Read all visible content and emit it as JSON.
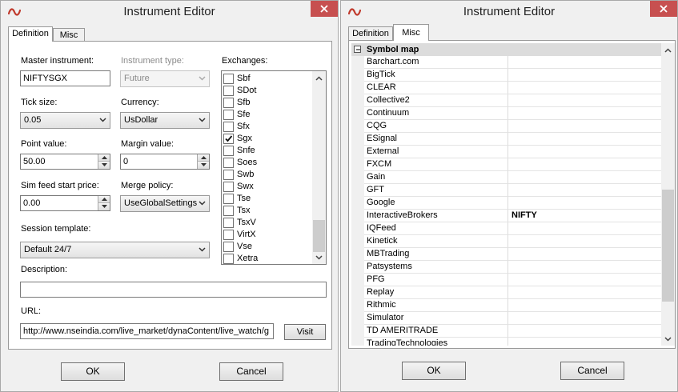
{
  "left_window": {
    "title": "Instrument Editor",
    "tabs": [
      "Definition",
      "Misc"
    ],
    "master_instrument": {
      "label": "Master instrument:",
      "value": "NIFTYSGX"
    },
    "instrument_type": {
      "label": "Instrument type:",
      "value": "Future"
    },
    "tick_size": {
      "label": "Tick size:",
      "value": "0.05"
    },
    "currency": {
      "label": "Currency:",
      "value": "UsDollar"
    },
    "point_value": {
      "label": "Point value:",
      "value": "50.00"
    },
    "margin_value": {
      "label": "Margin value:",
      "value": "0"
    },
    "sim_feed_start_price": {
      "label": "Sim feed start price:",
      "value": "0.00"
    },
    "merge_policy": {
      "label": "Merge policy:",
      "value": "UseGlobalSettings"
    },
    "session_template": {
      "label": "Session template:",
      "value": "Default 24/7"
    },
    "description": {
      "label": "Description:",
      "value": ""
    },
    "url": {
      "label": "URL:",
      "value": "http://www.nseindia.com/live_market/dynaContent/live_watch/g",
      "button": "Visit"
    },
    "exchanges": {
      "label": "Exchanges:",
      "items": [
        {
          "name": "Sbf",
          "checked": false
        },
        {
          "name": "SDot",
          "checked": false
        },
        {
          "name": "Sfb",
          "checked": false
        },
        {
          "name": "Sfe",
          "checked": false
        },
        {
          "name": "Sfx",
          "checked": false
        },
        {
          "name": "Sgx",
          "checked": true
        },
        {
          "name": "Snfe",
          "checked": false
        },
        {
          "name": "Soes",
          "checked": false
        },
        {
          "name": "Swb",
          "checked": false
        },
        {
          "name": "Swx",
          "checked": false
        },
        {
          "name": "Tse",
          "checked": false
        },
        {
          "name": "Tsx",
          "checked": false
        },
        {
          "name": "TsxV",
          "checked": false
        },
        {
          "name": "VirtX",
          "checked": false
        },
        {
          "name": "Vse",
          "checked": false
        },
        {
          "name": "Xetra",
          "checked": false
        }
      ]
    },
    "ok_label": "OK",
    "cancel_label": "Cancel"
  },
  "right_window": {
    "title": "Instrument Editor",
    "tabs": [
      "Definition",
      "Misc"
    ],
    "category": "Symbol map",
    "rows": [
      {
        "name": "Barchart.com",
        "value": ""
      },
      {
        "name": "BigTick",
        "value": ""
      },
      {
        "name": "CLEAR",
        "value": ""
      },
      {
        "name": "Collective2",
        "value": ""
      },
      {
        "name": "Continuum",
        "value": ""
      },
      {
        "name": "CQG",
        "value": ""
      },
      {
        "name": "ESignal",
        "value": ""
      },
      {
        "name": "External",
        "value": ""
      },
      {
        "name": "FXCM",
        "value": ""
      },
      {
        "name": "Gain",
        "value": ""
      },
      {
        "name": "GFT",
        "value": ""
      },
      {
        "name": "Google",
        "value": ""
      },
      {
        "name": "InteractiveBrokers",
        "value": "NIFTY"
      },
      {
        "name": "IQFeed",
        "value": ""
      },
      {
        "name": "Kinetick",
        "value": ""
      },
      {
        "name": "MBTrading",
        "value": ""
      },
      {
        "name": "Patsystems",
        "value": ""
      },
      {
        "name": "PFG",
        "value": ""
      },
      {
        "name": "Replay",
        "value": ""
      },
      {
        "name": "Rithmic",
        "value": ""
      },
      {
        "name": "Simulator",
        "value": ""
      },
      {
        "name": "TD AMERITRADE",
        "value": ""
      },
      {
        "name": "TradingTechnologies",
        "value": ""
      }
    ],
    "ok_label": "OK",
    "cancel_label": "Cancel"
  },
  "colors": {
    "close_button": "#c75050",
    "window_bg": "#f0f0f0",
    "app_icon": "#c0392b"
  },
  "icons": [
    "app-icon",
    "close-icon",
    "chevron-down-icon",
    "spin-up-icon",
    "spin-down-icon",
    "checkmark-icon",
    "collapse-icon"
  ]
}
